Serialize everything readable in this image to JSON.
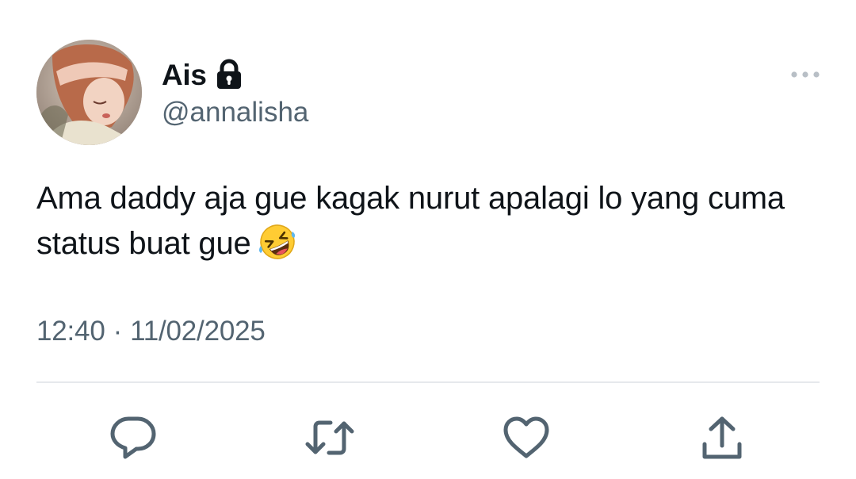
{
  "author": {
    "display_name": "Ais",
    "handle": "@annalisha",
    "protected": true,
    "avatar": "avatar-image"
  },
  "tweet": {
    "text": "Ama daddy aja gue kagak nurut apalagi lo yang cuma status buat gue",
    "emoji": "rolling-on-the-floor-laughing",
    "time": "12:40",
    "separator": "·",
    "date": "11/02/2025"
  },
  "actions": [
    {
      "name": "reply",
      "icon": "reply-icon"
    },
    {
      "name": "retweet",
      "icon": "retweet-icon"
    },
    {
      "name": "like",
      "icon": "heart-icon"
    },
    {
      "name": "share",
      "icon": "share-icon"
    }
  ],
  "colors": {
    "text_primary": "#0f1419",
    "text_secondary": "#536471",
    "divider": "#e6e9ec",
    "icon": "#536471"
  }
}
